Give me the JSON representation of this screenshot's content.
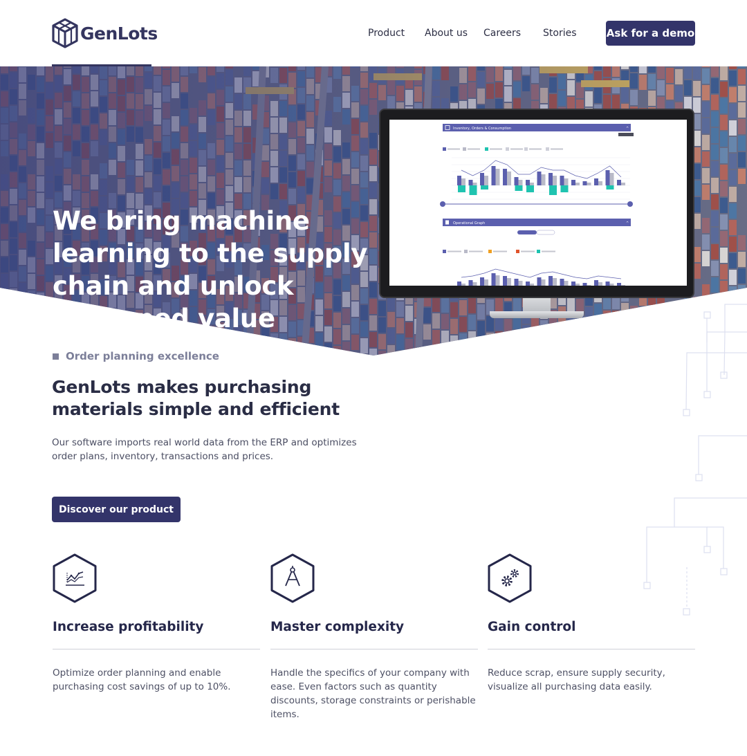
{
  "header": {
    "logo_text": "GenLots",
    "nav": [
      "Product",
      "About us",
      "Careers",
      "Stories"
    ],
    "cta_label": "Ask for a demo"
  },
  "hero": {
    "title": "We bring machine learning to the supply chain and unlock untapped value"
  },
  "dashboard": {
    "panel1_title": "Inventory, Orders & Consumption",
    "panel2_title": "Operational Graph"
  },
  "intro": {
    "eyebrow": "Order planning excellence",
    "title": "GenLots makes purchasing materials simple and efficient",
    "text": "Our software imports real world data from the ERP and optimizes order plans, inventory, transactions and prices.",
    "button_label": "Discover our product"
  },
  "features": [
    {
      "icon": "chart-icon",
      "title": "Increase profitability",
      "text": "Optimize order planning and enable purchasing cost savings of up to 10%."
    },
    {
      "icon": "compass-icon",
      "title": "Master complexity",
      "text": "Handle the specifics of your company with ease. Even factors such as quantity discounts, storage constraints or perishable items."
    },
    {
      "icon": "gears-icon",
      "title": "Gain control",
      "text": "Reduce scrap, ensure supply security, visualize all purchasing data easily."
    }
  ],
  "colors": {
    "brand": "#33346a",
    "hero_overlay": "#3b3f7a",
    "chart_bar": "#5b5fae",
    "chart_teal": "#1fc3b0"
  }
}
